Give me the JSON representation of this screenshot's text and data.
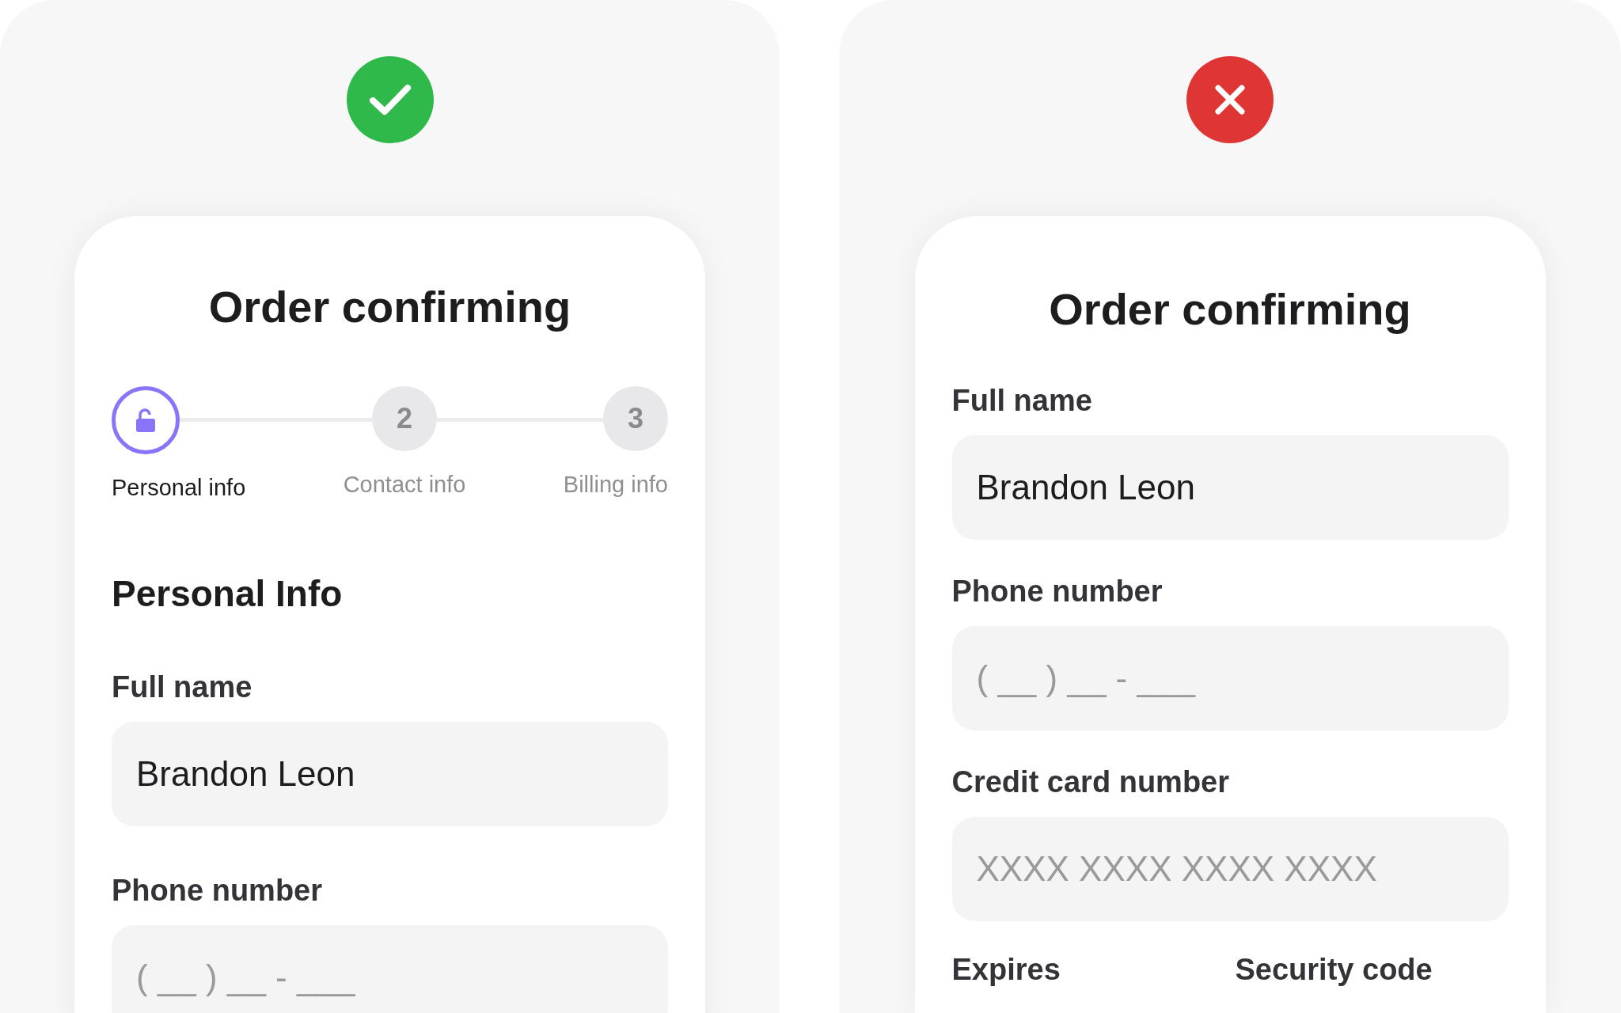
{
  "panels": [
    {
      "kind": "good",
      "card": {
        "title": "Order confirming",
        "stepper": [
          {
            "label": "Personal info",
            "selected": true
          },
          {
            "number": "2",
            "label": "Contact info",
            "selected": false
          },
          {
            "number": "3",
            "label": "Billing info",
            "selected": false
          }
        ],
        "section_heading": "Personal Info",
        "fields": [
          {
            "label": "Full name",
            "value": "Brandon Leon"
          },
          {
            "label": "Phone number",
            "placeholder": "( __ ) __ - ___"
          }
        ]
      }
    },
    {
      "kind": "bad",
      "card": {
        "title": "Order confirming",
        "fields": [
          {
            "label": "Full name",
            "value": "Brandon Leon"
          },
          {
            "label": "Phone number",
            "placeholder": "( __ ) __ - ___"
          },
          {
            "label": "Credit card number",
            "placeholder": "XXXX XXXX XXXX XXXX"
          }
        ],
        "bottom_labels": [
          "Expires",
          "Security code"
        ]
      }
    }
  ]
}
